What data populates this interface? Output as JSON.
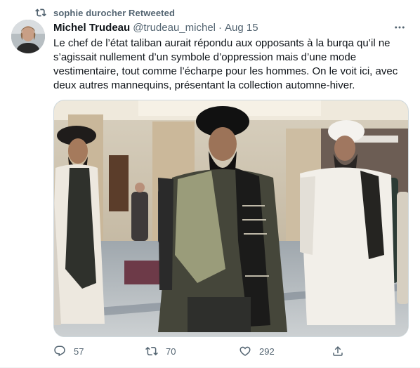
{
  "retweet_context": {
    "label": "sophie durocher Retweeted",
    "icon": "retweet-icon"
  },
  "tweet": {
    "author_name": "Michel Trudeau",
    "author_handle": "@trudeau_michel",
    "separator": "·",
    "timestamp": "Aug 15",
    "text": "Le chef de l’état taliban aurait répondu aux opposants à la burqa qu’il ne s’agissait nullement d’un symbole d’oppression mais d’une mode vestimentaire, tout comme l’écharpe pour les hommes. On le voit ici, avec deux autres mannequins, présentant la collection automne-hiver.",
    "more_icon": "more-icon"
  },
  "actions": {
    "reply": {
      "icon": "reply-icon",
      "count": "57"
    },
    "retweet": {
      "icon": "retweet-icon",
      "count": "70"
    },
    "like": {
      "icon": "heart-icon",
      "count": "292"
    },
    "share": {
      "icon": "share-icon"
    }
  },
  "colors": {
    "secondary_text": "#536471",
    "primary_text": "#0f1419",
    "border": "#cfd9de"
  }
}
